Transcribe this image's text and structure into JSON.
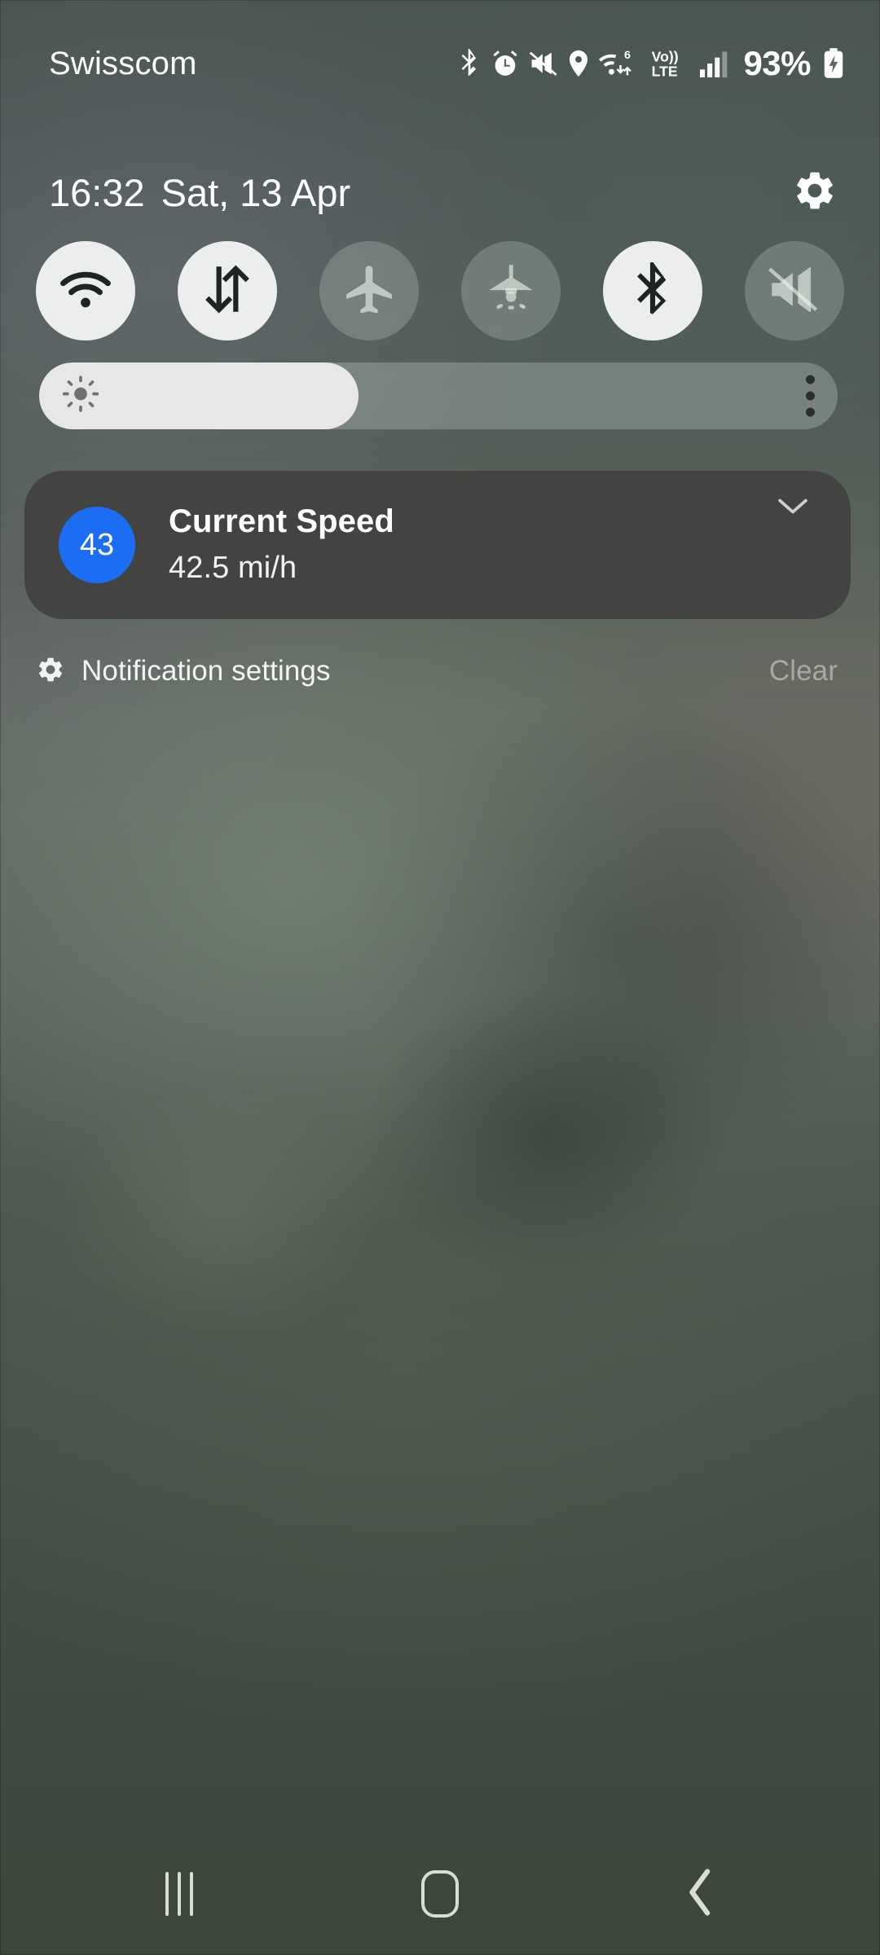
{
  "status_bar": {
    "carrier": "Swisscom",
    "battery_percent": "93%",
    "icons": [
      "bluetooth-icon",
      "alarm-icon",
      "mute-icon",
      "location-icon",
      "wifi-6-data-icon",
      "volte-icon",
      "signal-bars-icon",
      "battery-charging-icon"
    ],
    "wifi_generation": "6",
    "volte_top": "Vo))",
    "volte_bottom": "LTE"
  },
  "header": {
    "time": "16:32",
    "date": "Sat, 13 Apr",
    "settings_icon": "gear-icon"
  },
  "quick_settings": {
    "tiles": [
      {
        "name": "wifi",
        "icon": "wifi-icon",
        "state": "on"
      },
      {
        "name": "mobile-data",
        "icon": "data-arrows-icon",
        "state": "on"
      },
      {
        "name": "airplane",
        "icon": "airplane-icon",
        "state": "off"
      },
      {
        "name": "flashlight",
        "icon": "flashlight-icon",
        "state": "off"
      },
      {
        "name": "bluetooth",
        "icon": "bluetooth-icon",
        "state": "on"
      },
      {
        "name": "sound-mute",
        "icon": "mute-icon",
        "state": "off"
      }
    ]
  },
  "brightness": {
    "icon": "brightness-sun-icon",
    "level_percent": 40,
    "overflow_icon": "more-vertical-icon"
  },
  "notification": {
    "badge": "43",
    "badge_color": "#1b6ef3",
    "title": "Current Speed",
    "body": "42.5 mi/h",
    "expand_icon": "chevron-down-icon"
  },
  "notification_footer": {
    "settings_icon": "gear-icon",
    "settings_label": "Notification settings",
    "clear_label": "Clear"
  },
  "nav_bar": {
    "recents_icon": "recents-icon",
    "home_icon": "home-icon",
    "back_icon": "back-chevron-icon"
  }
}
